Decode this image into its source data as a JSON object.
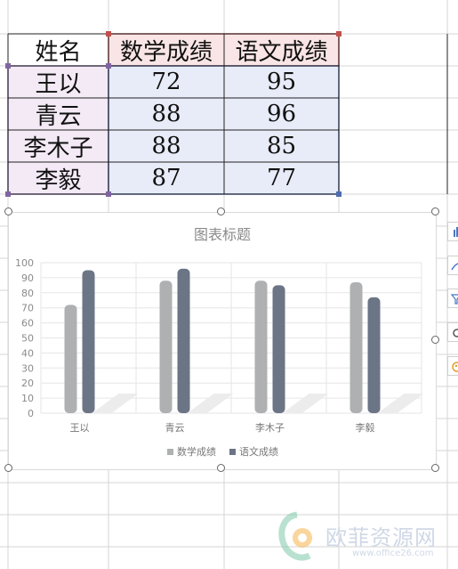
{
  "table": {
    "headers": [
      "姓名",
      "数学成绩",
      "语文成绩"
    ],
    "rows": [
      {
        "name": "王以",
        "math": "72",
        "chinese": "95"
      },
      {
        "name": "青云",
        "math": "88",
        "chinese": "96"
      },
      {
        "name": "李木子",
        "math": "88",
        "chinese": "85"
      },
      {
        "name": "李毅",
        "math": "87",
        "chinese": "77"
      }
    ]
  },
  "chart_data": {
    "type": "bar",
    "title": "图表标题",
    "categories": [
      "王以",
      "青云",
      "李木子",
      "李毅"
    ],
    "series": [
      {
        "name": "数学成绩",
        "values": [
          72,
          88,
          88,
          87
        ],
        "color": "#aeb0b1"
      },
      {
        "name": "语文成绩",
        "values": [
          95,
          96,
          85,
          77
        ],
        "color": "#6b7586"
      }
    ],
    "ylim": [
      0,
      100
    ],
    "yticks": [
      0,
      10,
      20,
      30,
      40,
      50,
      60,
      70,
      80,
      90,
      100
    ],
    "grid": true,
    "legend": "bottom"
  },
  "side_toolbar": {
    "icons": [
      "chart-elements-icon",
      "chart-style-icon",
      "chart-filter-icon",
      "chart-settings-icon",
      "chart-color-icon"
    ]
  },
  "watermark": {
    "text": "欧菲资源网",
    "url": "www.office26.com",
    "colors": {
      "primary": "#cfd8e6",
      "accent": "#f5b24a",
      "green": "#7fc8a9"
    }
  },
  "colors": {
    "gridline": "#d4d4d4",
    "header_bg": "#f9e5e5",
    "header_border": "#c0504d",
    "name_bg": "#f3eaf6",
    "name_border": "#8064a2",
    "data_bg": "#e8ecf8",
    "data_border": "#4f6bb0"
  }
}
